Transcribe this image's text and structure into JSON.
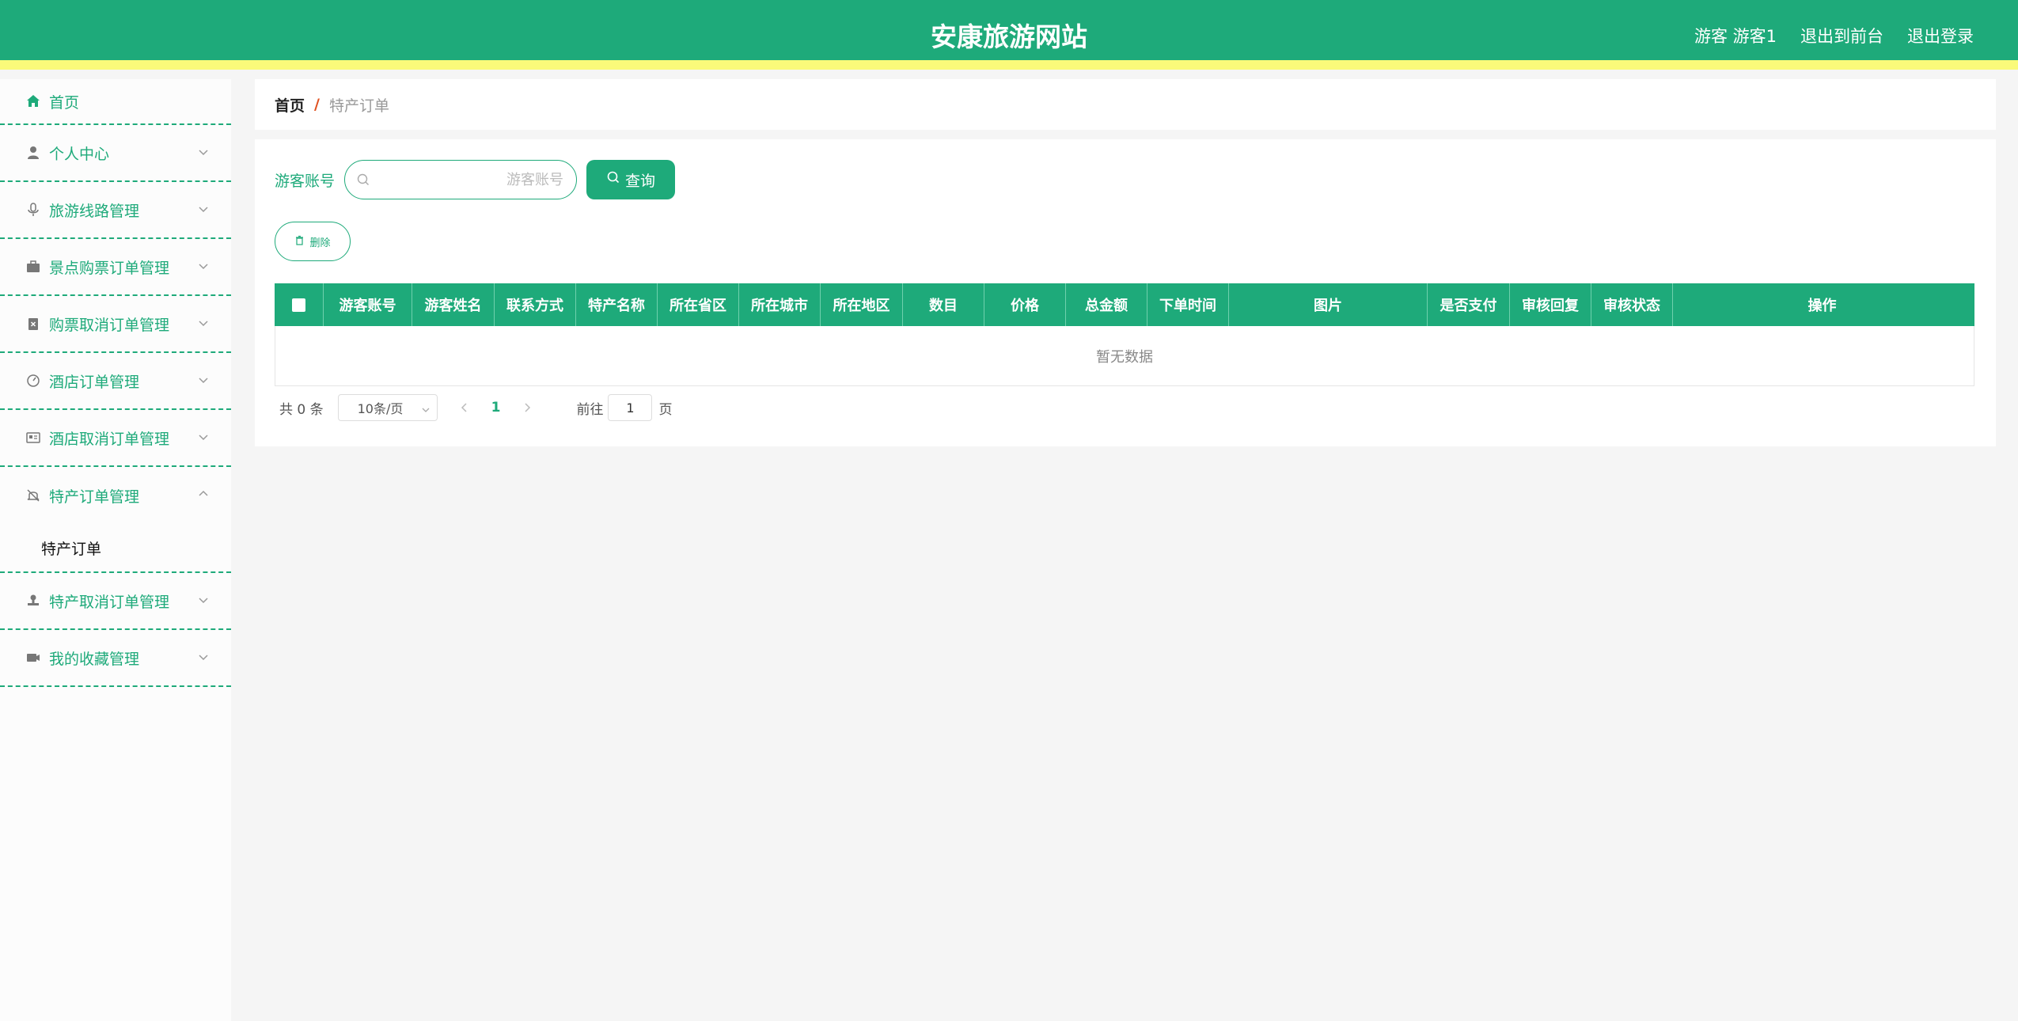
{
  "header": {
    "title": "安康旅游网站",
    "user": "游客 游客1",
    "back_to_front": "退出到前台",
    "logout": "退出登录"
  },
  "sidebar": {
    "home": {
      "label": "首页",
      "icon": "home-icon"
    },
    "items": [
      {
        "label": "个人中心",
        "icon": "user-icon"
      },
      {
        "label": "旅游线路管理",
        "icon": "microphone-icon"
      },
      {
        "label": "景点购票订单管理",
        "icon": "briefcase-icon"
      },
      {
        "label": "购票取消订单管理",
        "icon": "clipboard-x-icon"
      },
      {
        "label": "酒店订单管理",
        "icon": "gauge-icon"
      },
      {
        "label": "酒店取消订单管理",
        "icon": "id-card-icon"
      },
      {
        "label": "特产订单管理",
        "icon": "bell-off-icon",
        "expanded": true,
        "children": [
          "特产订单"
        ]
      },
      {
        "label": "特产取消订单管理",
        "icon": "stamp-icon"
      },
      {
        "label": "我的收藏管理",
        "icon": "camera-icon"
      }
    ]
  },
  "breadcrumb": {
    "home": "首页",
    "separator": "/",
    "current": "特产订单"
  },
  "search": {
    "label": "游客账号",
    "placeholder": "游客账号",
    "value": "",
    "button": "查询"
  },
  "actions": {
    "delete": "删除"
  },
  "table": {
    "columns": [
      "",
      "游客账号",
      "游客姓名",
      "联系方式",
      "特产名称",
      "所在省区",
      "所在城市",
      "所在地区",
      "数目",
      "价格",
      "总金额",
      "下单时间",
      "图片",
      "是否支付",
      "审核回复",
      "审核状态",
      "操作"
    ],
    "rows": [],
    "empty_text": "暂无数据"
  },
  "pagination": {
    "total_text": "共 0 条",
    "page_size": "10条/页",
    "current_page": "1",
    "goto_label": "前往",
    "goto_value": "1",
    "goto_unit": "页"
  },
  "colors": {
    "primary": "#1eaa7a",
    "accent_stripe": "#fafa7a",
    "breadcrumb_sep": "#e0501f"
  }
}
